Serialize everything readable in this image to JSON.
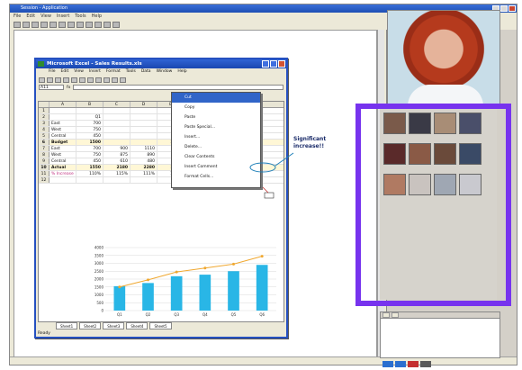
{
  "window": {
    "title": "Session - Application",
    "menu": [
      "File",
      "Edit",
      "View",
      "Insert",
      "Tools",
      "Help"
    ]
  },
  "excel": {
    "title": "Microsoft Excel - Sales Results.xls",
    "menu": [
      "File",
      "Edit",
      "View",
      "Insert",
      "Format",
      "Tools",
      "Data",
      "Window",
      "Help"
    ],
    "namebox": "A11",
    "columns": [
      "",
      "A",
      "B",
      "C",
      "D",
      "E",
      "F"
    ],
    "rows": [
      {
        "n": "1",
        "cells": [
          "",
          "",
          "",
          "",
          "",
          ""
        ]
      },
      {
        "n": "2",
        "cells": [
          "",
          "Q1",
          "",
          "",
          "Q4",
          "Q4"
        ]
      },
      {
        "n": "3",
        "cells": [
          "East",
          "700",
          "",
          "",
          "1000",
          "1200"
        ]
      },
      {
        "n": "4",
        "cells": [
          "West",
          "750",
          "",
          "",
          "870",
          "750"
        ]
      },
      {
        "n": "5",
        "cells": [
          "Central",
          "450",
          "",
          "",
          "500",
          "720"
        ]
      },
      {
        "n": "6",
        "cells": [
          "Budget",
          "1500",
          "",
          "",
          "2300",
          "2690"
        ]
      },
      {
        "n": "7",
        "cells": [
          "East",
          "700",
          "900",
          "1110",
          "1500",
          "1350"
        ]
      },
      {
        "n": "8",
        "cells": [
          "West",
          "750",
          "875",
          "890",
          "755",
          "550"
        ]
      },
      {
        "n": "9",
        "cells": [
          "Central",
          "450",
          "610",
          "480",
          "500",
          "720"
        ]
      },
      {
        "n": "10",
        "cells": [
          "Actual",
          "1550",
          "2180",
          "2280",
          "2900",
          "2690"
        ]
      },
      {
        "n": "11",
        "cells": [
          "% Increase",
          "110%",
          "115%",
          "111%",
          "112%",
          "120%"
        ]
      },
      {
        "n": "12",
        "cells": [
          "",
          "",
          "",
          "",
          "",
          ""
        ]
      }
    ],
    "context_menu": [
      "Cut",
      "Copy",
      "Paste",
      "Paste Special...",
      "Insert...",
      "Delete...",
      "Clear Contents",
      "Insert Comment",
      "Format Cells..."
    ],
    "sheet_tabs": [
      "Sheet1",
      "Sheet2",
      "Sheet3",
      "Sheet4",
      "Sheet5"
    ],
    "status": "Ready"
  },
  "callout": {
    "line1": "Significant",
    "line2": "increase!!"
  },
  "chart_data": {
    "type": "bar",
    "categories": [
      "Q1",
      "Q2",
      "Q3",
      "Q4",
      "Q5",
      "Q6"
    ],
    "series": [
      {
        "values": [
          1550,
          1750,
          2180,
          2280,
          2500,
          2900
        ],
        "color": "#29b6e6"
      },
      {
        "type": "line",
        "values": [
          1500,
          1950,
          2450,
          2700,
          2950,
          3450
        ],
        "color": "#f0a830"
      }
    ],
    "ylim": [
      0,
      4000
    ],
    "yticks": [
      "4000",
      "3500",
      "3000",
      "2500",
      "2000",
      "1500",
      "1000",
      "500",
      "0"
    ],
    "grid": true
  },
  "accent_color": "#7733ee"
}
